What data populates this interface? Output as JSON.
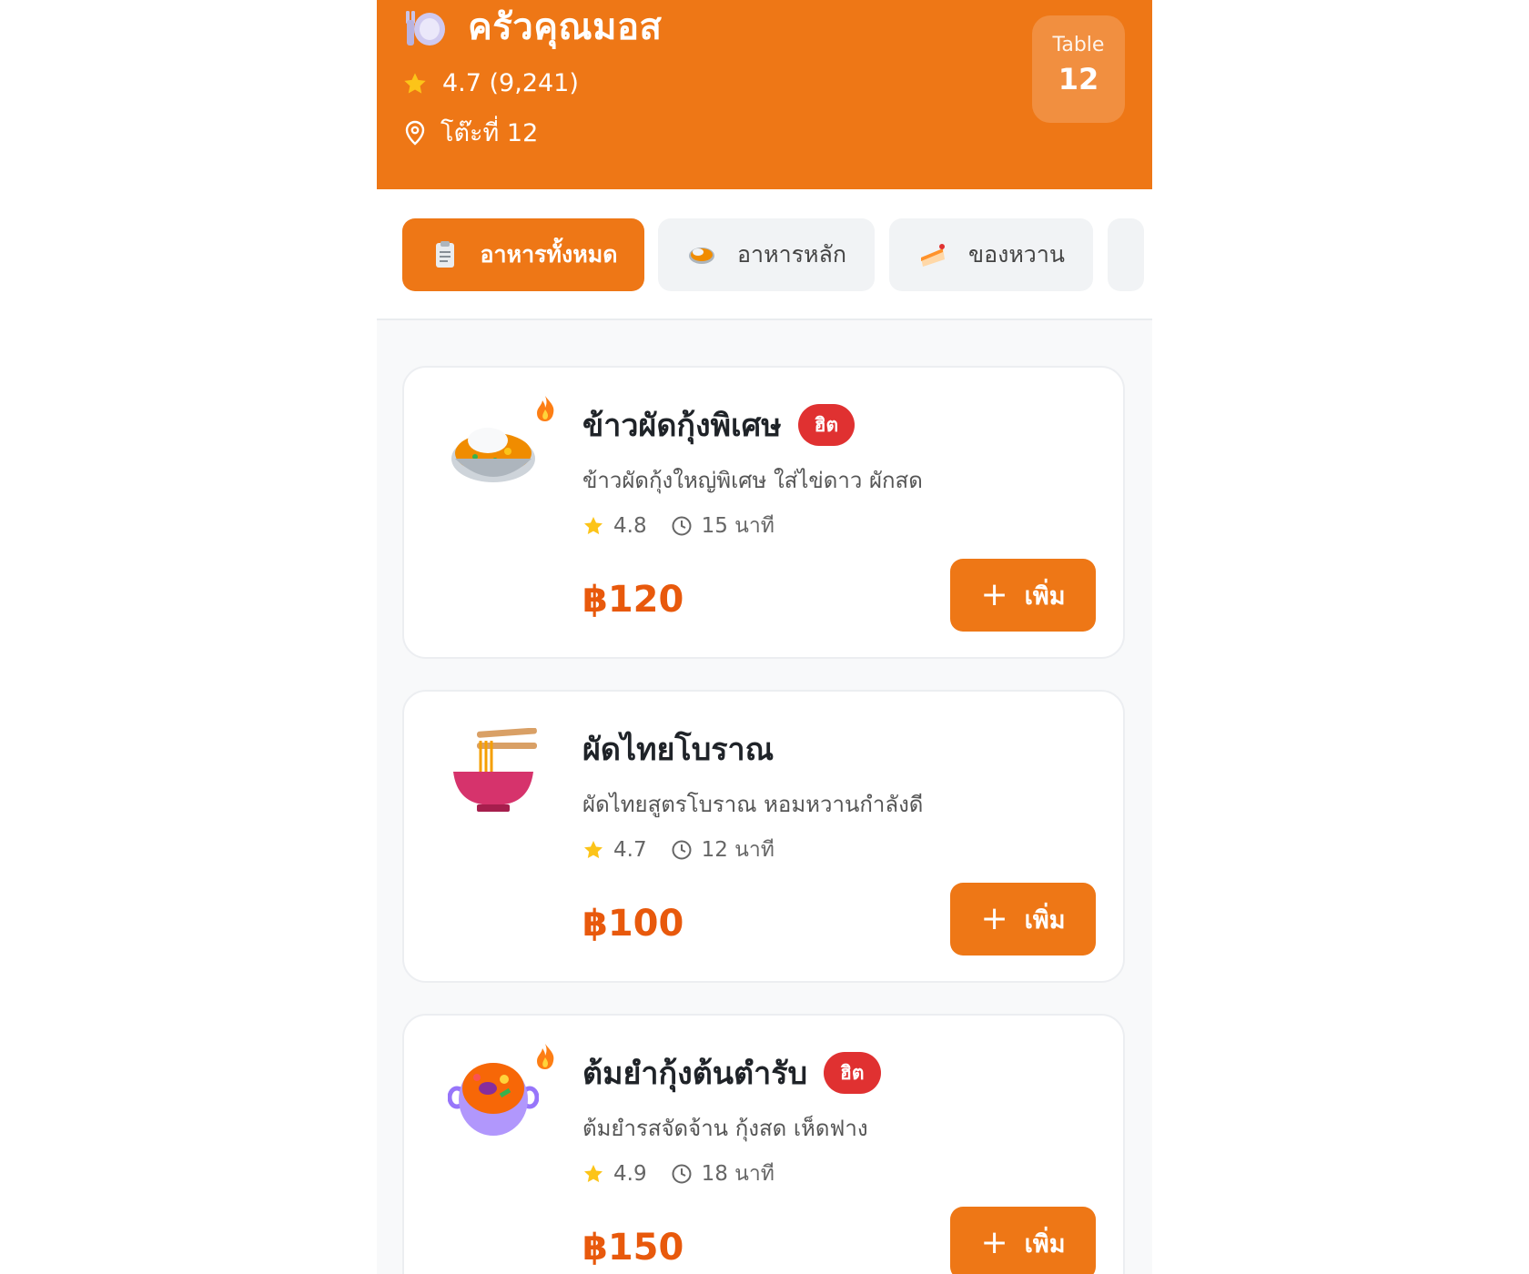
{
  "header": {
    "restaurant_name": "ครัวคุณมอส",
    "rating": "4.7 (9,241)",
    "location": "โต๊ะที่ 12",
    "table_label": "Table",
    "table_number": "12",
    "brand_color": "#ee7716"
  },
  "tabs": [
    {
      "label": "อาหารทั้งหมด",
      "icon": "clipboard-icon",
      "active": true
    },
    {
      "label": "อาหารหลัก",
      "icon": "rice-bowl-icon",
      "active": false
    },
    {
      "label": "ของหวาน",
      "icon": "cake-icon",
      "active": false
    }
  ],
  "menu": [
    {
      "name": "ข้าวผัดกุ้งพิเศษ",
      "badge": "ฮิต",
      "description": "ข้าวผัดกุ้งใหญ่พิเศษ ใส่ไข่ดาว ผักสด",
      "rating": "4.8",
      "time": "15 นาที",
      "price": "฿120",
      "add_label": "เพิ่ม",
      "icon": "fried-rice-icon"
    },
    {
      "name": "ผัดไทยโบราณ",
      "badge": "",
      "description": "ผัดไทยสูตรโบราณ หอมหวานกำลังดี",
      "rating": "4.7",
      "time": "12 นาที",
      "price": "฿100",
      "add_label": "เพิ่ม",
      "icon": "noodle-bowl-icon"
    },
    {
      "name": "ต้มยำกุ้งต้นตำรับ",
      "badge": "ฮิต",
      "description": "ต้มยำรสจัดจ้าน กุ้งสด เห็ดฟาง",
      "rating": "4.9",
      "time": "18 นาที",
      "price": "฿150",
      "add_label": "เพิ่ม",
      "icon": "soup-pot-icon"
    }
  ],
  "colors": {
    "accent": "#ee7716",
    "price": "#e8590c",
    "hot_badge": "#e03131",
    "star": "#fcc419"
  }
}
